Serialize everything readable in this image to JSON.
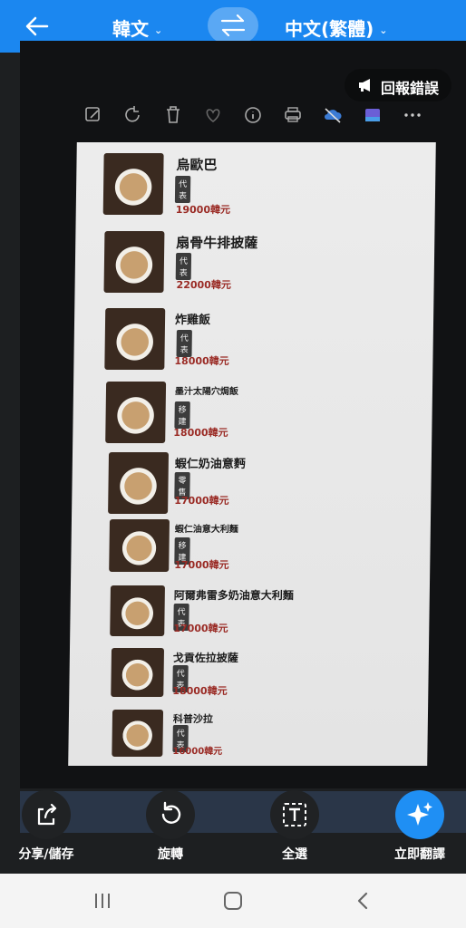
{
  "header": {
    "source_language": "韓文",
    "target_language": "中文(繁體)",
    "back_icon": "arrow-left-icon",
    "swap_icon": "swap-arrows-icon",
    "chevron_icon": "chevron-down-icon"
  },
  "report_button": {
    "label": "回報錯誤",
    "icon": "megaphone-icon"
  },
  "photo_toolbar": [
    "edit-image-icon",
    "rotate-icon",
    "trash-icon",
    "heart-icon",
    "info-icon",
    "print-icon",
    "cloud-off-icon",
    "gallery-icon",
    "more-icon"
  ],
  "menu": {
    "items": [
      {
        "name": "烏歐巴",
        "tag": "代表",
        "price": "19000韓元"
      },
      {
        "name": "扇骨牛排披薩",
        "tag": "代表",
        "price": "22000韓元"
      },
      {
        "name": "炸雞飯",
        "tag": "代表",
        "price": "18000韓元"
      },
      {
        "name": "墨汁太陽穴焗飯",
        "tag": "移建",
        "price": "18000韓元"
      },
      {
        "name": "蝦仁奶油意麪",
        "tag": "零售",
        "price": "17000韓元"
      },
      {
        "name": "蝦仁油意大利麵",
        "tag": "移建",
        "price": "17000韓元"
      },
      {
        "name": "阿爾弗雷多奶油意大利麵",
        "tag": "代表",
        "price": "17000韓元"
      },
      {
        "name": "戈貢佐拉披薩",
        "tag": "代表",
        "price": "18000韓元"
      },
      {
        "name": "科普沙拉",
        "tag": "代表",
        "price": "16000韓元"
      }
    ]
  },
  "actions": {
    "share": {
      "label": "分享/儲存",
      "icon": "share-icon"
    },
    "rotate": {
      "label": "旋轉",
      "icon": "rotate-icon"
    },
    "select_all": {
      "label": "全選",
      "icon": "select-text-icon"
    },
    "translate": {
      "label": "立即翻譯",
      "icon": "sparkle-icon"
    }
  },
  "accent_color": "#1b87f0"
}
